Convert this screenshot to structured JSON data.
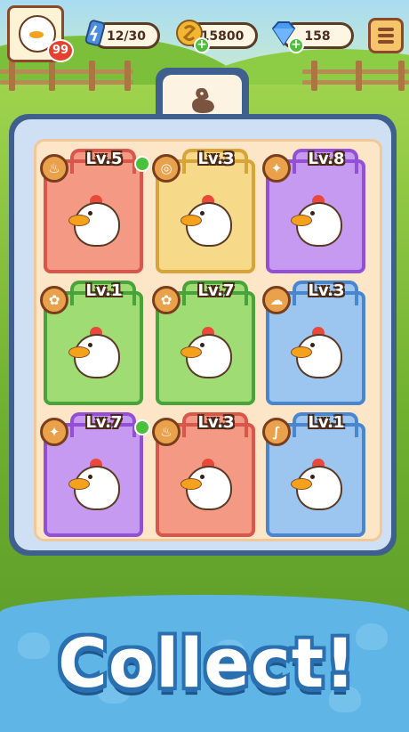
{
  "header": {
    "player_level": "99",
    "energy": "12/30",
    "gold": "15800",
    "gems": "158"
  },
  "colors": {
    "red": "#f49a84",
    "yellow": "#f7d98a",
    "purple": "#c59af0",
    "green": "#9fdc73",
    "blue": "#9cc6ef"
  },
  "cards": [
    {
      "level": "Lv.5",
      "element": "flame-icon",
      "rarity": "red",
      "has_dot": true
    },
    {
      "level": "Lv.3",
      "element": "wind-icon",
      "rarity": "yellow",
      "has_dot": false
    },
    {
      "level": "Lv.8",
      "element": "star-icon",
      "rarity": "purple",
      "has_dot": false
    },
    {
      "level": "Lv.1",
      "element": "leaf-icon",
      "rarity": "green",
      "has_dot": false
    },
    {
      "level": "Lv.7",
      "element": "leaf-icon",
      "rarity": "green",
      "has_dot": false
    },
    {
      "level": "Lv.3",
      "element": "cloud-icon",
      "rarity": "blue",
      "has_dot": false
    },
    {
      "level": "Lv.7",
      "element": "star-icon",
      "rarity": "purple",
      "has_dot": true
    },
    {
      "level": "Lv.3",
      "element": "flame-icon",
      "rarity": "red",
      "has_dot": false
    },
    {
      "level": "Lv.1",
      "element": "feather-icon",
      "rarity": "blue",
      "has_dot": false
    }
  ],
  "footer": {
    "title": "Collect!"
  }
}
